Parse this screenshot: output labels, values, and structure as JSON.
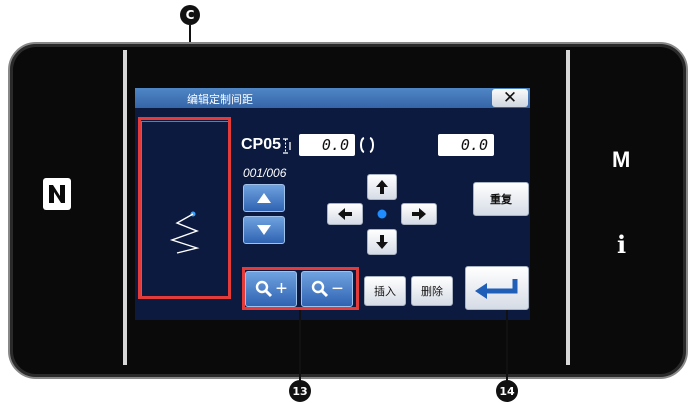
{
  "callouts": {
    "c_label": "C",
    "c13_label": "13",
    "c14_label": "14"
  },
  "dialog": {
    "title": "编辑定制间距",
    "close_label": "✕"
  },
  "pattern": {
    "name": "CP05",
    "pitch_value": "0.0",
    "angle_value": "0.0",
    "counter": "001/006"
  },
  "buttons": {
    "repeat_label": "重复",
    "insert_label": "插入",
    "delete_label": "删除",
    "zoom_in_label": "+",
    "zoom_out_label": "−"
  },
  "side_right": {
    "m_label": "M",
    "info_label": "i"
  },
  "colors": {
    "screen_bg": "#0b1a3e",
    "accent_blue": "#2f63b2",
    "highlight_red": "#e33a3a"
  }
}
